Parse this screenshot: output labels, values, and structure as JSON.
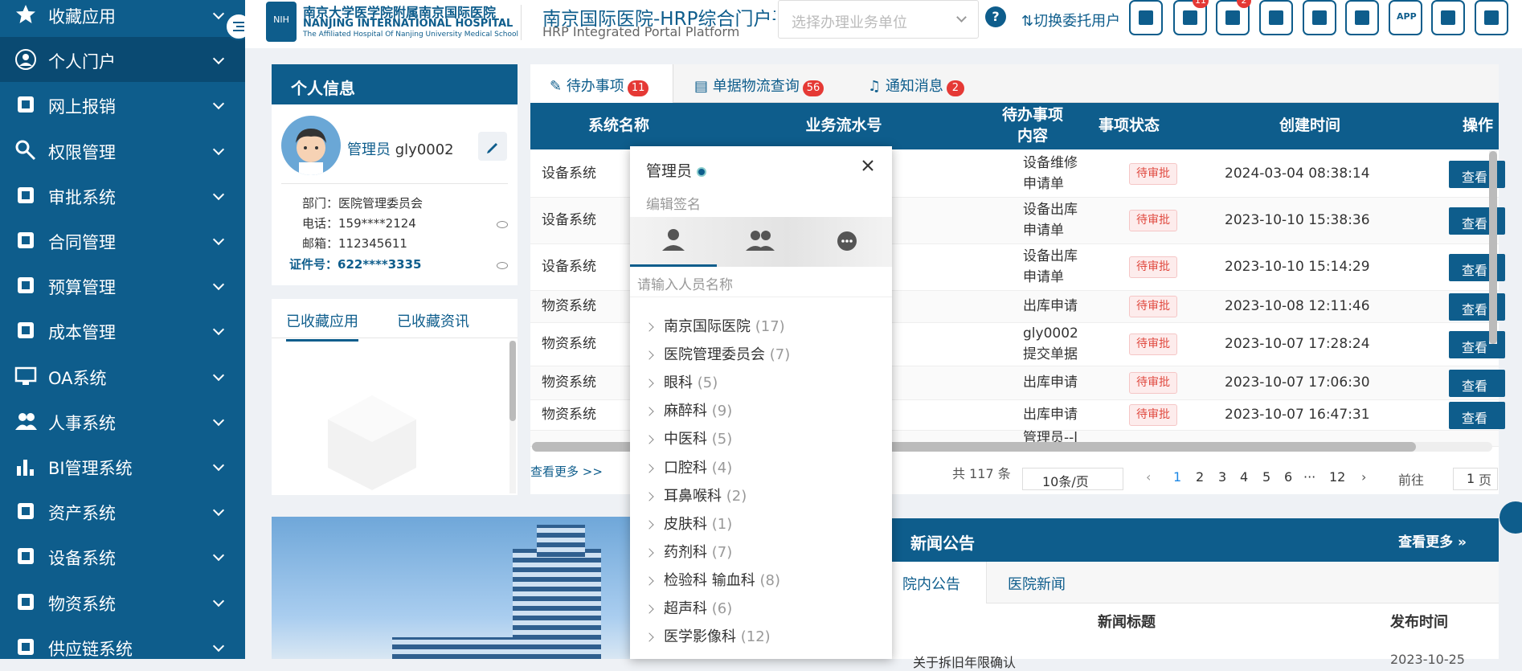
{
  "sidebar": {
    "items": [
      {
        "label": "收藏应用",
        "icon": "star-icon"
      },
      {
        "label": "个人门户",
        "icon": "user-circle-icon"
      },
      {
        "label": "网上报销",
        "icon": "reimburse-icon"
      },
      {
        "label": "权限管理",
        "icon": "key-icon"
      },
      {
        "label": "审批系统",
        "icon": "stamp-icon"
      },
      {
        "label": "合同管理",
        "icon": "contract-icon"
      },
      {
        "label": "预算管理",
        "icon": "money-bag-icon"
      },
      {
        "label": "成本管理",
        "icon": "cost-book-icon"
      },
      {
        "label": "OA系统",
        "icon": "monitor-icon"
      },
      {
        "label": "人事系统",
        "icon": "users-icon"
      },
      {
        "label": "BI管理系统",
        "icon": "bar-chart-icon"
      },
      {
        "label": "资产系统",
        "icon": "coins-icon"
      },
      {
        "label": "设备系统",
        "icon": "books-icon"
      },
      {
        "label": "物资系统",
        "icon": "boxes-icon"
      },
      {
        "label": "供应链系统",
        "icon": "network-icon"
      }
    ]
  },
  "header": {
    "logo_cn": "南京大学医学院附属南京国际医院",
    "logo_en": "NANJING INTERNATIONAL HOSPITAL",
    "logo_sub": "The Affiliated Hospital Of Nanjing University Medical School",
    "logo_mark": "NIH",
    "portal_title": "南京国际医院-HRP综合门户平台",
    "portal_subtitle": "HRP Integrated Portal Platform",
    "unit_placeholder": "选择办理业务单位",
    "help": "?",
    "switch_label": "切换委托用户",
    "toolbar": [
      {
        "icon": "home-icon",
        "badge": ""
      },
      {
        "icon": "list-icon",
        "badge": "11"
      },
      {
        "icon": "speaker-icon",
        "badge": "2"
      },
      {
        "icon": "grid-icon",
        "badge": ""
      },
      {
        "icon": "sliders-icon",
        "badge": ""
      },
      {
        "icon": "settings-icon",
        "badge": ""
      },
      {
        "icon": "app-icon",
        "badge": ""
      },
      {
        "icon": "fullscreen-icon",
        "badge": ""
      },
      {
        "icon": "power-icon",
        "badge": ""
      }
    ],
    "app_icon_text": "APP"
  },
  "profile": {
    "title": "个人信息",
    "role": "管理员",
    "username": "gly0002",
    "dept_label": "部门：",
    "dept": "医院管理委员会",
    "phone_label": "电话：",
    "phone": "159****2124",
    "email_label": "邮箱：",
    "email": "112345611",
    "id_label": "证件号：",
    "id": "622****3335"
  },
  "favorites": {
    "tab1": "已收藏应用",
    "tab2": "已收藏资讯"
  },
  "tasks": {
    "tabs": [
      {
        "label": "待办事项",
        "count": "11"
      },
      {
        "label": "单据物流查询",
        "count": "56"
      },
      {
        "label": "通知消息",
        "count": "2"
      }
    ],
    "columns": [
      "系统名称",
      "业务流水号",
      "待办事项\n内容",
      "事项状态",
      "创建时间",
      "操作"
    ],
    "rows": [
      {
        "system": "设备系统",
        "content": "设备维修\n申请单",
        "status": "待审批",
        "time": "2024-03-04 08:38:14",
        "action": "查看"
      },
      {
        "system": "设备系统",
        "content": "设备出库\n申请单",
        "status": "待审批",
        "time": "2023-10-10 15:38:36",
        "action": "查看"
      },
      {
        "system": "设备系统",
        "content": "设备出库\n申请单",
        "status": "待审批",
        "time": "2023-10-10 15:14:29",
        "action": "查看"
      },
      {
        "system": "物资系统",
        "content": "出库申请",
        "status": "待审批",
        "time": "2023-10-08 12:11:46",
        "action": "查看"
      },
      {
        "system": "物资系统",
        "content": "gly0002\n提交单据",
        "status": "待审批",
        "time": "2023-10-07 17:28:24",
        "action": "查看"
      },
      {
        "system": "物资系统",
        "content": "出库申请",
        "status": "待审批",
        "time": "2023-10-07 17:06:30",
        "action": "查看"
      },
      {
        "system": "物资系统",
        "content": "出库申请",
        "status": "待审批",
        "time": "2023-10-07 16:47:31",
        "action": "查看"
      },
      {
        "system": "",
        "content": "管理员--l",
        "status": "",
        "time": "",
        "action": ""
      }
    ],
    "more": "查看更多 >>",
    "total": "共 117 条",
    "page_size": "10条/页",
    "pages": [
      "1",
      "2",
      "3",
      "4",
      "5",
      "6",
      "···",
      "12"
    ],
    "goto_label": "前往",
    "goto_value": "1",
    "page_unit": "页"
  },
  "news": {
    "title": "新闻公告",
    "more": "查看更多",
    "tabs": [
      "院内公告",
      "医院新闻"
    ],
    "col_title": "新闻标题",
    "col_time": "发布时间",
    "first_title": "关于拆旧年限确认",
    "first_time": "2023-10-25"
  },
  "popup": {
    "name": "管理员",
    "signature": "编辑签名",
    "tabs": [
      "person-icon",
      "group-icon",
      "chat-icon"
    ],
    "search_placeholder": "请输入人员名称",
    "tree": [
      {
        "name": "南京国际医院",
        "count": "(17)"
      },
      {
        "name": "医院管理委员会",
        "count": "(7)"
      },
      {
        "name": "眼科",
        "count": "(5)"
      },
      {
        "name": "麻醉科",
        "count": "(9)"
      },
      {
        "name": "中医科",
        "count": "(5)"
      },
      {
        "name": "口腔科",
        "count": "(4)"
      },
      {
        "name": "耳鼻喉科",
        "count": "(2)"
      },
      {
        "name": "皮肤科",
        "count": "(1)"
      },
      {
        "name": "药剂科",
        "count": "(7)"
      },
      {
        "name": "检验科 输血科",
        "count": "(8)"
      },
      {
        "name": "超声科",
        "count": "(6)"
      },
      {
        "name": "医学影像科",
        "count": "(12)"
      }
    ]
  },
  "colors": {
    "primary": "#0e5d8c",
    "badge": "#e53935",
    "status": "#e0493f"
  }
}
